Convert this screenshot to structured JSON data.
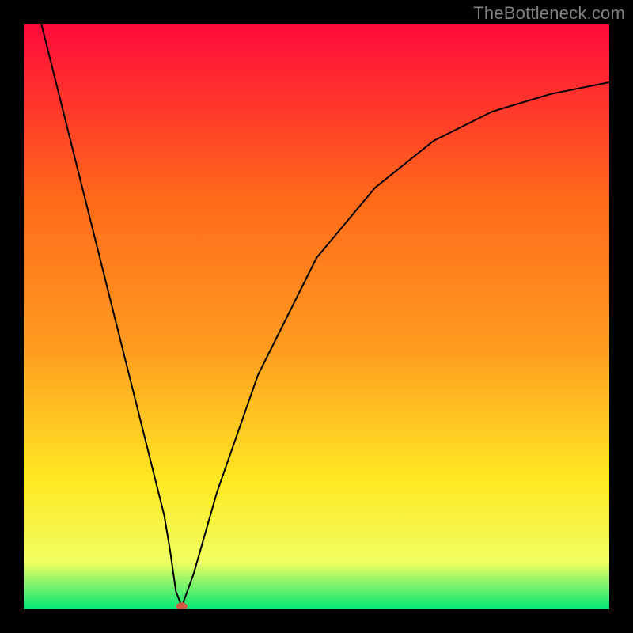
{
  "watermark": "TheBottleneck.com",
  "chart_data": {
    "type": "line",
    "title": "",
    "xlabel": "",
    "ylabel": "",
    "xlim": [
      0,
      100
    ],
    "ylim": [
      0,
      100
    ],
    "series": [
      {
        "name": "bottleneck-curve",
        "color": "#000000",
        "x": [
          3,
          10,
          15,
          20,
          24,
          25,
          26,
          27,
          29,
          33,
          40,
          50,
          60,
          70,
          80,
          90,
          100
        ],
        "y": [
          100,
          72,
          52,
          32,
          16,
          10,
          3,
          0.5,
          6,
          20,
          40,
          60,
          72,
          80,
          85,
          88,
          90
        ]
      }
    ],
    "marker": {
      "name": "current-point",
      "x": 27,
      "y": 0.5,
      "color": "#d15a42"
    },
    "background_gradient": {
      "top": "#ff0a3a",
      "mid_upper": "#ff9b20",
      "mid": "#ffe822",
      "mid_lower": "#f0ff60",
      "bottom": "#00e676"
    }
  }
}
